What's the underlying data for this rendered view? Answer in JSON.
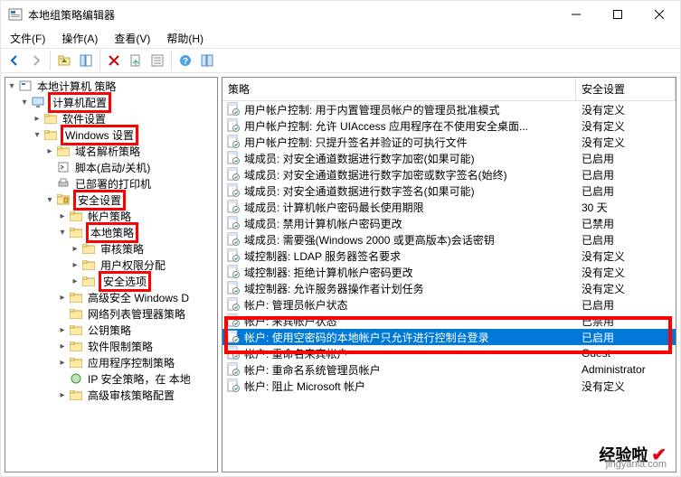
{
  "window": {
    "title": "本地组策略编辑器"
  },
  "menubar": {
    "items": [
      "文件(F)",
      "操作(A)",
      "查看(V)",
      "帮助(H)"
    ]
  },
  "tree": {
    "root": "本地计算机 策略",
    "computer_config": "计算机配置",
    "software_settings": "软件设置",
    "windows_settings": "Windows 设置",
    "dns_policy": "域名解析策略",
    "scripts": "脚本(启动/关机)",
    "deployed_printers": "已部署的打印机",
    "security_settings": "安全设置",
    "account_policies": "帐户策略",
    "local_policies": "本地策略",
    "audit_policy": "审核策略",
    "user_rights": "用户权限分配",
    "security_options": "安全选项",
    "advanced_security": "高级安全 Windows D",
    "network_list": "网络列表管理器策略",
    "public_key": "公钥策略",
    "software_restriction": "软件限制策略",
    "appcontrol": "应用程序控制策略",
    "ip_security": "IP 安全策略，在 本地",
    "advanced_audit": "高级审核策略配置"
  },
  "list": {
    "columns": {
      "policy": "策略",
      "setting": "安全设置"
    },
    "rows": [
      {
        "p": "用户帐户控制: 用于内置管理员帐户的管理员批准模式",
        "s": "没有定义"
      },
      {
        "p": "用户帐户控制: 允许 UIAccess 应用程序在不使用安全桌面...",
        "s": "没有定义"
      },
      {
        "p": "用户帐户控制: 只提升签名并验证的可执行文件",
        "s": "没有定义"
      },
      {
        "p": "域成员: 对安全通道数据进行数字加密(如果可能)",
        "s": "已启用"
      },
      {
        "p": "域成员: 对安全通道数据进行数字加密或数字签名(始终)",
        "s": "已启用"
      },
      {
        "p": "域成员: 对安全通道数据进行数字签名(如果可能)",
        "s": "已启用"
      },
      {
        "p": "域成员: 计算机帐户密码最长使用期限",
        "s": "30 天"
      },
      {
        "p": "域成员: 禁用计算机帐户密码更改",
        "s": "已禁用"
      },
      {
        "p": "域成员: 需要强(Windows 2000 或更高版本)会话密钥",
        "s": "已启用"
      },
      {
        "p": "域控制器: LDAP 服务器签名要求",
        "s": "没有定义"
      },
      {
        "p": "域控制器: 拒绝计算机帐户密码更改",
        "s": "没有定义"
      },
      {
        "p": "域控制器: 允许服务器操作者计划任务",
        "s": "没有定义"
      },
      {
        "p": "帐户: 管理员帐户状态",
        "s": "已启用"
      },
      {
        "p": "帐户: 来宾帐户状态",
        "s": "已禁用"
      },
      {
        "p": "帐户: 使用空密码的本地帐户只允许进行控制台登录",
        "s": "已启用",
        "selected": true
      },
      {
        "p": "帐户: 重命名来宾帐户",
        "s": "Guest"
      },
      {
        "p": "帐户: 重命名系统管理员帐户",
        "s": "Administrator"
      },
      {
        "p": "帐户: 阻止 Microsoft 帐户",
        "s": "没有定义"
      }
    ]
  },
  "watermark": {
    "text1": "经验啦",
    "url": "jingyanla.com"
  }
}
